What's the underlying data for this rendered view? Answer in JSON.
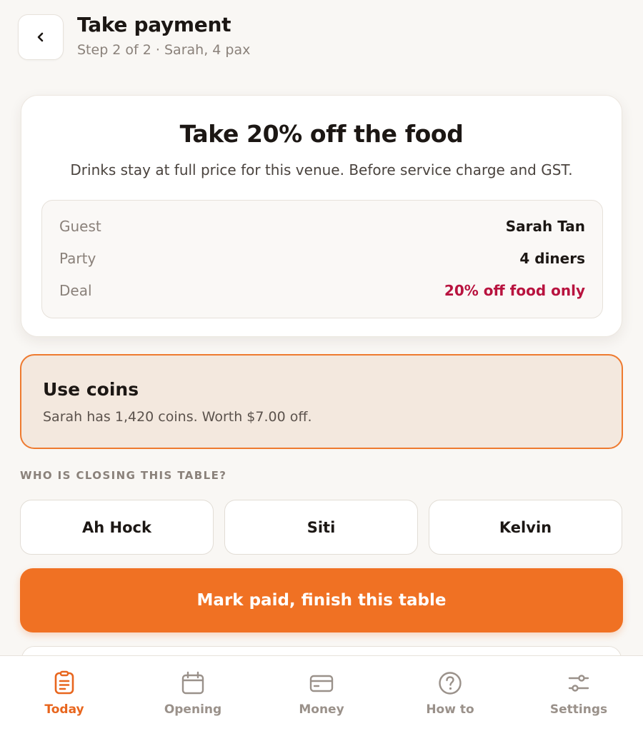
{
  "header": {
    "title": "Take payment",
    "subtitle": "Step 2 of 2 · Sarah, 4 pax",
    "back_icon": "chevron-left-icon"
  },
  "deal": {
    "title": "Take 20% off the food",
    "description": "Drinks stay at full price for this venue. Before service charge and GST.",
    "rows": [
      {
        "label": "Guest",
        "value": "Sarah Tan"
      },
      {
        "label": "Party",
        "value": "4 diners"
      },
      {
        "label": "Deal",
        "value": "20% off food only"
      }
    ]
  },
  "coins": {
    "title": "Use coins",
    "description": "Sarah has 1,420 coins. Worth $7.00 off."
  },
  "closing": {
    "label": "WHO IS CLOSING THIS TABLE?",
    "staff": [
      "Ah Hock",
      "Siti",
      "Kelvin"
    ]
  },
  "primary_action": "Mark paid, finish this table",
  "tabs": [
    {
      "label": "Today",
      "icon": "clipboard-list-icon",
      "active": true
    },
    {
      "label": "Opening",
      "icon": "calendar-icon",
      "active": false
    },
    {
      "label": "Money",
      "icon": "card-icon",
      "active": false
    },
    {
      "label": "How to",
      "icon": "help-circle-icon",
      "active": false
    },
    {
      "label": "Settings",
      "icon": "sliders-icon",
      "active": false
    }
  ],
  "colors": {
    "accent": "#f07123",
    "deal_text": "#b8133f",
    "coins_bg": "#f3e8de",
    "background": "#f9f7f4"
  }
}
